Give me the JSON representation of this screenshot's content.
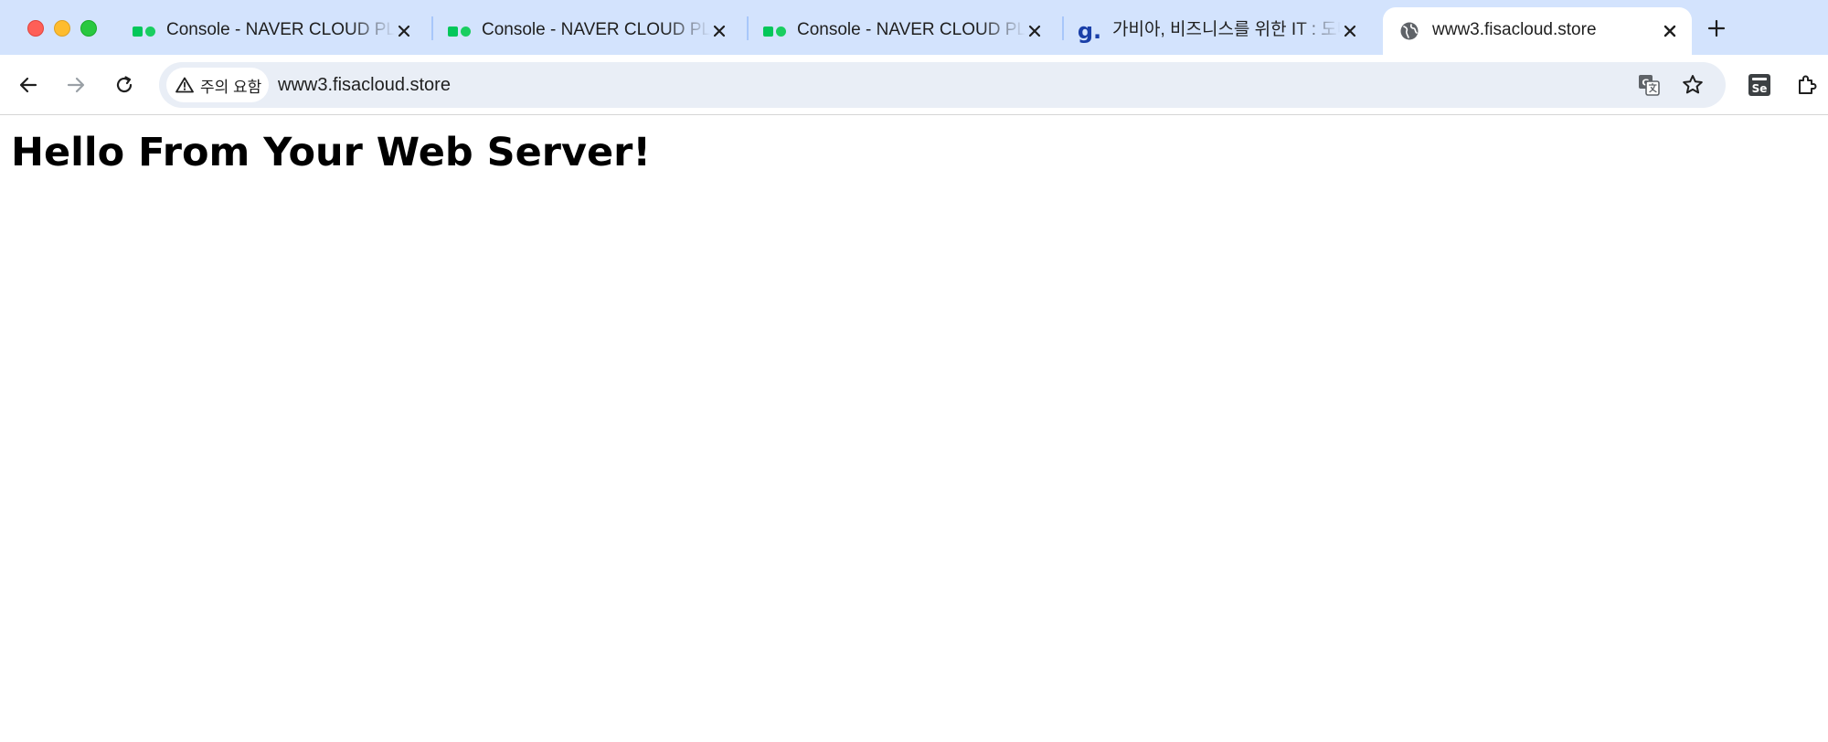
{
  "browser": {
    "tabs": [
      {
        "title": "Console - NAVER CLOUD PLATFORM",
        "favicon": "naver-cloud-icon",
        "active": false
      },
      {
        "title": "Console - NAVER CLOUD PLATFORM",
        "favicon": "naver-cloud-icon",
        "active": false
      },
      {
        "title": "Console - NAVER CLOUD PLATFORM",
        "favicon": "naver-cloud-icon",
        "active": false
      },
      {
        "title": "가비아, 비즈니스를 위한 IT : 도메인",
        "favicon": "gabia-icon",
        "active": false
      },
      {
        "title": "www3.fisacloud.store",
        "favicon": "globe-icon",
        "active": true
      }
    ],
    "new_tab_label": "+",
    "security_chip": {
      "label": "주의 요함"
    },
    "url": "www3.fisacloud.store",
    "gabia_favicon_glyph": "g.",
    "extension_badge": "Se"
  },
  "page": {
    "heading": "Hello From Your Web Server!"
  },
  "colors": {
    "tabstrip_bg": "#d3e3fd",
    "active_tab_bg": "#ffffff",
    "omnibox_bg": "#e9eef6",
    "naver_green": "#03c75a",
    "gabia_blue": "#1a3fa8"
  }
}
